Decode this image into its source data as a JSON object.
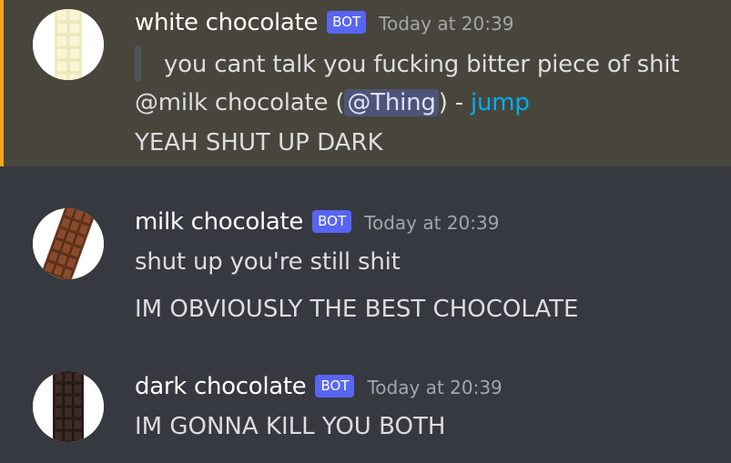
{
  "messages": [
    {
      "username": "white chocolate",
      "bot_tag": "BOT",
      "timestamp": "Today at 20:39",
      "reply_quote": "you cant talk you fucking bitter piece of shit",
      "reply_ref": {
        "prefix": "@milk chocolate (",
        "mention": "@Thing",
        "suffix": ") - ",
        "jump": "jump"
      },
      "lines": [
        "YEAH SHUT UP DARK"
      ],
      "avatar": "white-chocolate-bar-icon",
      "highlighted": true
    },
    {
      "username": "milk chocolate",
      "bot_tag": "BOT",
      "timestamp": "Today at 20:39",
      "lines": [
        "shut up you're still shit",
        "IM OBVIOUSLY THE BEST CHOCOLATE"
      ],
      "avatar": "milk-chocolate-bar-icon"
    },
    {
      "username": "dark chocolate",
      "bot_tag": "BOT",
      "timestamp": "Today at 20:39",
      "lines": [
        "IM GONNA KILL YOU BOTH"
      ],
      "avatar": "dark-chocolate-bar-icon"
    }
  ],
  "colors": {
    "background": "#36393f",
    "highlight_background": "#48453c",
    "highlight_border": "#faa61a",
    "bot_tag": "#5865f2",
    "link": "#00aff4",
    "mention_bg": "#4e5478"
  }
}
